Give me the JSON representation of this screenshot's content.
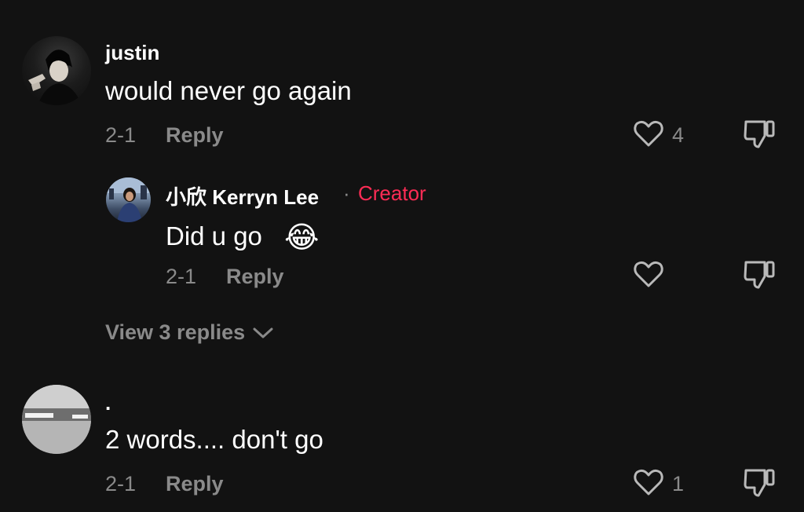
{
  "comments": [
    {
      "username": "justin",
      "text": "would never go again",
      "date": "2-1",
      "reply_label": "Reply",
      "like_count": "4"
    },
    {
      "username": "小欣 Kerryn Lee",
      "separator": "·",
      "badge": "Creator",
      "text": "Did u go",
      "emoji": "😂",
      "date": "2-1",
      "reply_label": "Reply"
    },
    {
      "username": ".",
      "text": "2 words.... don't go",
      "date": "2-1",
      "reply_label": "Reply",
      "like_count": "1"
    }
  ],
  "view_replies": "View 3 replies",
  "icons": {
    "like": "heart-outline-icon",
    "dislike": "thumbs-down-icon",
    "expand": "chevron-down-icon"
  },
  "colors": {
    "background": "#121212",
    "text": "#ffffff",
    "muted": "#8a8a8a",
    "creator": "#fe2c55"
  }
}
